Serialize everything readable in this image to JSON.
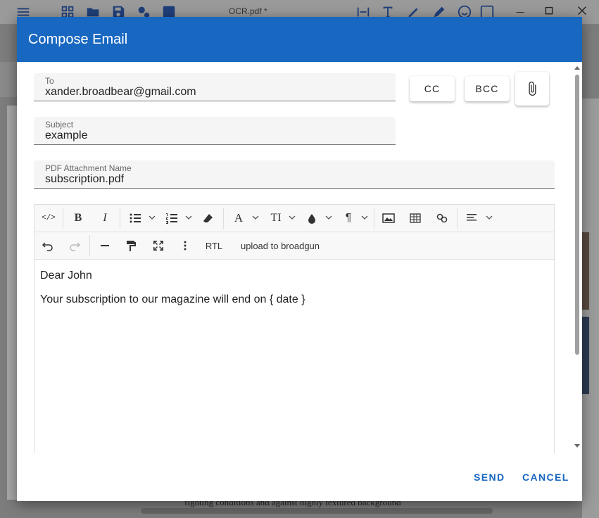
{
  "app": {
    "document_title": "OCR.pdf *",
    "background_text": "fighting conditions and against highly textured background"
  },
  "dialog": {
    "title": "Compose Email",
    "to": {
      "label": "To",
      "value": "xander.broadbear@gmail.com"
    },
    "subject": {
      "label": "Subject",
      "value": "example"
    },
    "attachment_name": {
      "label": "PDF Attachment Name",
      "value": "subscription.pdf"
    },
    "cc_label": "CC",
    "bcc_label": "BCC",
    "editor": {
      "rtl_label": "RTL",
      "upload_label": "upload to broadgun",
      "body_lines": [
        "Dear John",
        "Your subscription to our magazine will end on { date }"
      ]
    },
    "send_label": "SEND",
    "cancel_label": "CANCEL"
  },
  "colors": {
    "header": "#1867c0",
    "accent": "#1867c0"
  }
}
